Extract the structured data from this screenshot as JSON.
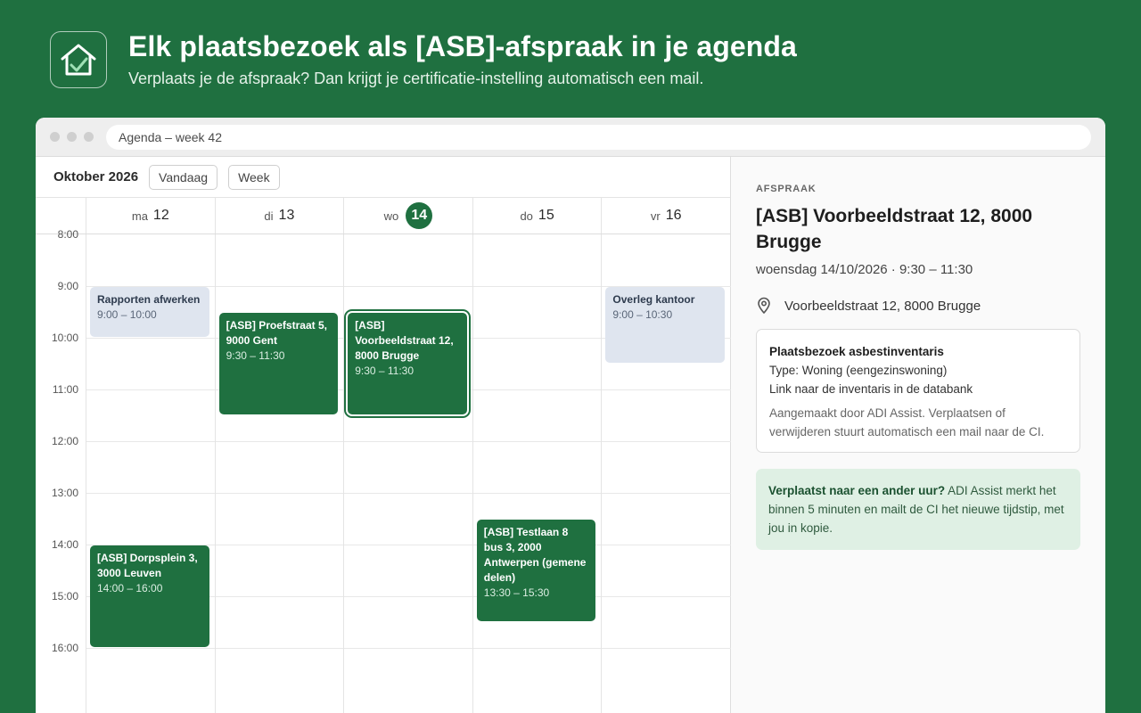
{
  "header": {
    "logo_icon": "house-check-icon",
    "title": "Elk plaatsbezoek als [ASB]-afspraak in je agenda",
    "subtitle": "Verplaats je de afspraak? Dan krijgt je certificatie-instelling automatisch een mail."
  },
  "browser": {
    "url": "Agenda – week 42"
  },
  "calendar": {
    "month": "Oktober 2026",
    "today_button": "Vandaag",
    "view_button": "Week",
    "days": [
      {
        "name": "ma",
        "num": "12"
      },
      {
        "name": "di",
        "num": "13"
      },
      {
        "name": "wo",
        "num": "14"
      },
      {
        "name": "do",
        "num": "15"
      },
      {
        "name": "vr",
        "num": "16"
      }
    ],
    "today_index": 2,
    "hours": [
      "8:00",
      "9:00",
      "10:00",
      "11:00",
      "12:00",
      "13:00",
      "14:00",
      "15:00",
      "16:00"
    ],
    "events": [
      {
        "day": 0,
        "start": 9.0,
        "end": 10.0,
        "kind": "own",
        "title": "Rapporten afwerken",
        "time": "9:00 – 10:00"
      },
      {
        "day": 1,
        "start": 9.5,
        "end": 11.5,
        "kind": "asb",
        "title": "[ASB] Proefstraat 5, 9000 Gent",
        "time": "9:30 – 11:30"
      },
      {
        "day": 2,
        "start": 9.5,
        "end": 11.5,
        "kind": "asb",
        "selected": true,
        "title": "[ASB] Voorbeeldstraat 12, 8000 Brugge",
        "time": "9:30 – 11:30"
      },
      {
        "day": 4,
        "start": 9.0,
        "end": 10.5,
        "kind": "own",
        "title": "Overleg kantoor",
        "time": "9:00 – 10:30"
      },
      {
        "day": 0,
        "start": 14.0,
        "end": 16.0,
        "kind": "asb",
        "title": "[ASB] Dorpsplein 3, 3000 Leuven",
        "time": "14:00 – 16:00"
      },
      {
        "day": 3,
        "start": 13.5,
        "end": 15.5,
        "kind": "asb",
        "title": "[ASB] Testlaan 8 bus 3, 2000 Antwerpen (gemene delen)",
        "time": "13:30 – 15:30"
      }
    ]
  },
  "details": {
    "kicker": "AFSPRAAK",
    "title": "[ASB] Voorbeeldstraat 12, 8000 Brugge",
    "when": "woensdag 14/10/2026 · 9:30 – 11:30",
    "location_icon": "map-pin-icon",
    "location": "Voorbeeldstraat 12, 8000 Brugge",
    "card_title": "Plaatsbezoek asbestinventaris",
    "card_type": "Type: Woning (eengezinswoning)",
    "card_link": "Link naar de inventaris in de databank",
    "card_note": "Aangemaakt door ADI Assist. Verplaatsen of verwijderen stuurt automatisch een mail naar de CI.",
    "tip_bold": "Verplaatst naar een ander uur?",
    "tip_text": " ADI Assist merkt het binnen 5 minuten en mailt de CI het nieuwe tijdstip, met jou in kopie."
  },
  "colors": {
    "brand": "#1f7040",
    "own_event": "#dfe5ef",
    "tip_bg": "#dff0e4"
  }
}
